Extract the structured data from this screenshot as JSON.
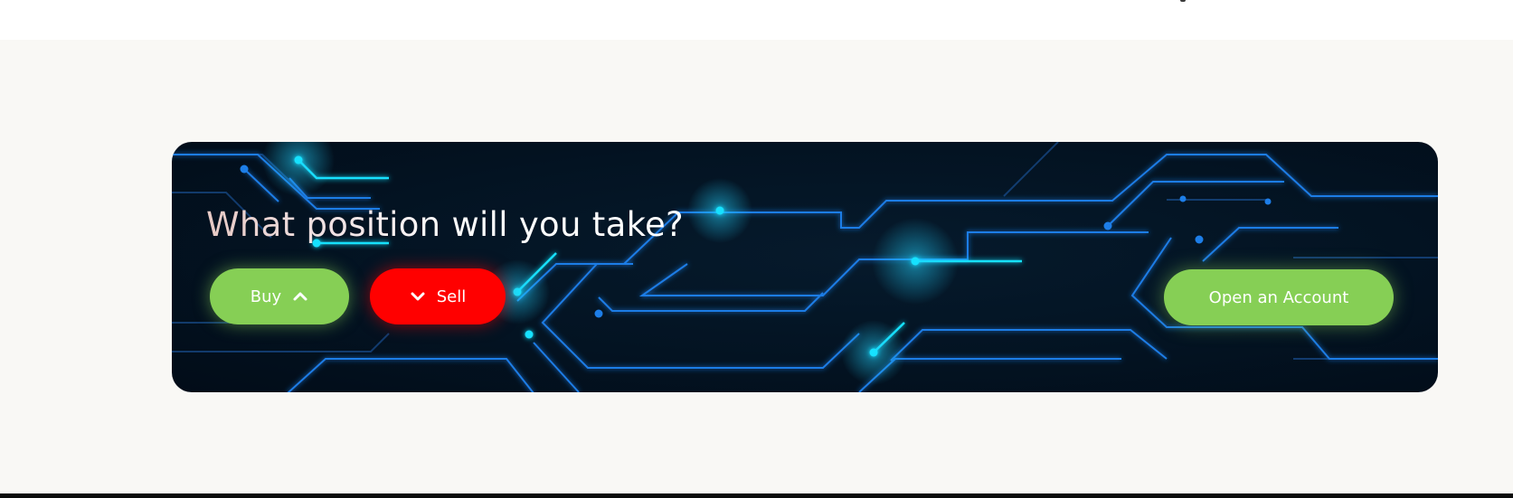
{
  "cta": {
    "headline": "What position will you take?",
    "buy_label": "Buy",
    "sell_label": "Sell",
    "open_account_label": "Open an Account"
  },
  "icons": {
    "buy": "chevron-up-icon",
    "sell": "chevron-down-icon"
  },
  "colors": {
    "page_background": "#f9f8f5",
    "banner_background": "#031322",
    "circuit_line": "#1e6fd6",
    "circuit_glow": "#19e1ff",
    "buy_button": "#86cf55",
    "sell_button": "#ff0000",
    "open_account_button": "#86cf55",
    "button_text": "#ffffff"
  }
}
